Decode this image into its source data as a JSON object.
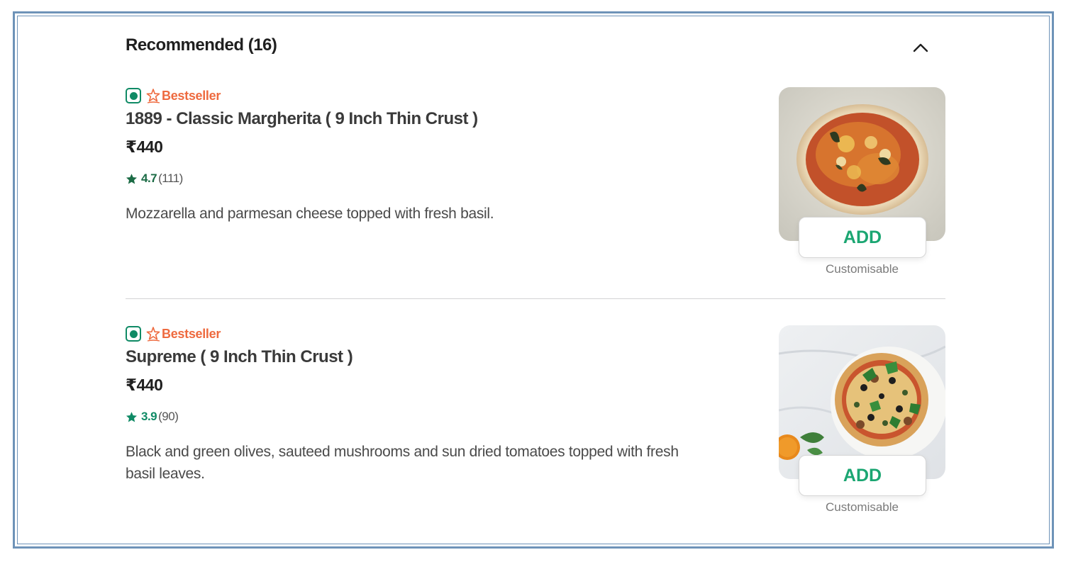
{
  "section": {
    "title": "Recommended (16)"
  },
  "items": [
    {
      "badge": "Bestseller",
      "name": "1889 - Classic Margherita ( 9 Inch Thin Crust )",
      "price": "₹440",
      "rating": "4.7",
      "rating_count": "(111)",
      "description": "Mozzarella and parmesan cheese topped with fresh basil.",
      "add_label": "ADD",
      "note": "Customisable",
      "rating_color": "#1b6b45",
      "image_icon": "pizza-margherita-image"
    },
    {
      "badge": "Bestseller",
      "name": "Supreme ( 9 Inch Thin Crust )",
      "price": "₹440",
      "rating": "3.9",
      "rating_count": "(90)",
      "description": "Black and green olives, sauteed mushrooms and sun dried tomatoes topped with fresh basil leaves.",
      "add_label": "ADD",
      "note": "Customisable",
      "rating_color": "#0f8a65",
      "image_icon": "pizza-supreme-image"
    }
  ],
  "colors": {
    "veg": "#0f8a65",
    "bestseller": "#ee6a3f",
    "add": "#1ba672",
    "frame": "#6e93b8"
  },
  "icons": {
    "collapse": "chevron-up-icon",
    "veg": "veg-icon",
    "bestseller": "star-badge-icon",
    "rating": "star-icon"
  }
}
